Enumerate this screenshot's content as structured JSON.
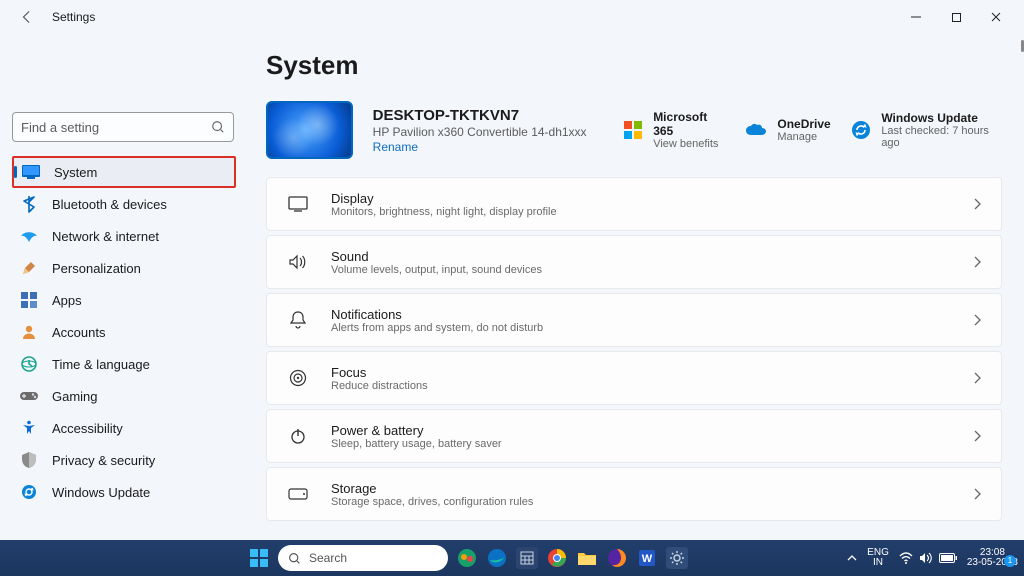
{
  "window": {
    "title": "Settings"
  },
  "page": {
    "heading": "System"
  },
  "search": {
    "placeholder": "Find a setting"
  },
  "nav": [
    {
      "id": "system",
      "label": "System",
      "selected": true,
      "highlighted": true
    },
    {
      "id": "bluetooth",
      "label": "Bluetooth & devices"
    },
    {
      "id": "network",
      "label": "Network & internet"
    },
    {
      "id": "personalization",
      "label": "Personalization"
    },
    {
      "id": "apps",
      "label": "Apps"
    },
    {
      "id": "accounts",
      "label": "Accounts"
    },
    {
      "id": "time",
      "label": "Time & language"
    },
    {
      "id": "gaming",
      "label": "Gaming"
    },
    {
      "id": "accessibility",
      "label": "Accessibility"
    },
    {
      "id": "privacy",
      "label": "Privacy & security"
    },
    {
      "id": "update",
      "label": "Windows Update"
    }
  ],
  "device": {
    "name": "DESKTOP-TKTKVN7",
    "model": "HP Pavilion x360 Convertible 14-dh1xxx",
    "rename": "Rename"
  },
  "services": {
    "m365": {
      "title": "Microsoft 365",
      "sub": "View benefits"
    },
    "onedrive": {
      "title": "OneDrive",
      "sub": "Manage"
    },
    "update": {
      "title": "Windows Update",
      "sub": "Last checked: 7 hours ago"
    }
  },
  "cards": [
    {
      "id": "display",
      "title": "Display",
      "sub": "Monitors, brightness, night light, display profile"
    },
    {
      "id": "sound",
      "title": "Sound",
      "sub": "Volume levels, output, input, sound devices"
    },
    {
      "id": "notifications",
      "title": "Notifications",
      "sub": "Alerts from apps and system, do not disturb"
    },
    {
      "id": "focus",
      "title": "Focus",
      "sub": "Reduce distractions"
    },
    {
      "id": "power",
      "title": "Power & battery",
      "sub": "Sleep, battery usage, battery saver"
    },
    {
      "id": "storage",
      "title": "Storage",
      "sub": "Storage space, drives, configuration rules"
    }
  ],
  "taskbar": {
    "search": "Search",
    "lang1": "ENG",
    "lang2": "IN",
    "time": "23:08",
    "date": "23-05-2023",
    "notif_count": "1"
  }
}
